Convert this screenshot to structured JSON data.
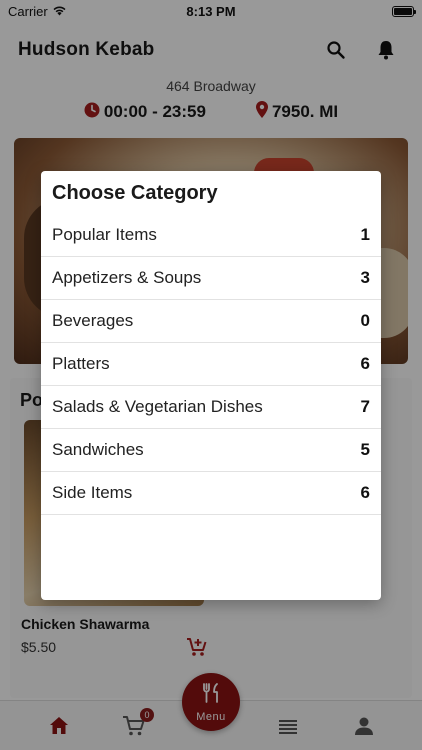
{
  "status_bar": {
    "carrier": "Carrier",
    "time": "8:13 PM"
  },
  "header": {
    "title": "Hudson Kebab",
    "search_icon": "search-icon",
    "notification_icon": "bell-icon"
  },
  "restaurant": {
    "address": "464 Broadway",
    "hours": "00:00 - 23:59",
    "distance": "7950. MI"
  },
  "popular": {
    "title": "Po",
    "items": [
      {
        "name": "Chicken Shawarma",
        "price": "$5.50"
      }
    ]
  },
  "category_modal": {
    "title": "Choose Category",
    "categories": [
      {
        "name": "Popular Items",
        "count": "1"
      },
      {
        "name": "Appetizers & Soups",
        "count": "3"
      },
      {
        "name": "Beverages",
        "count": "0"
      },
      {
        "name": "Platters",
        "count": "6"
      },
      {
        "name": "Salads & Vegetarian Dishes",
        "count": "7"
      },
      {
        "name": "Sandwiches",
        "count": "5"
      },
      {
        "name": "Side Items",
        "count": "6"
      }
    ]
  },
  "bottom_nav": {
    "menu_label": "Menu",
    "cart_count": "0"
  },
  "colors": {
    "accent": "#8a1313",
    "overlay": "rgba(0,0,0,0.40)"
  }
}
